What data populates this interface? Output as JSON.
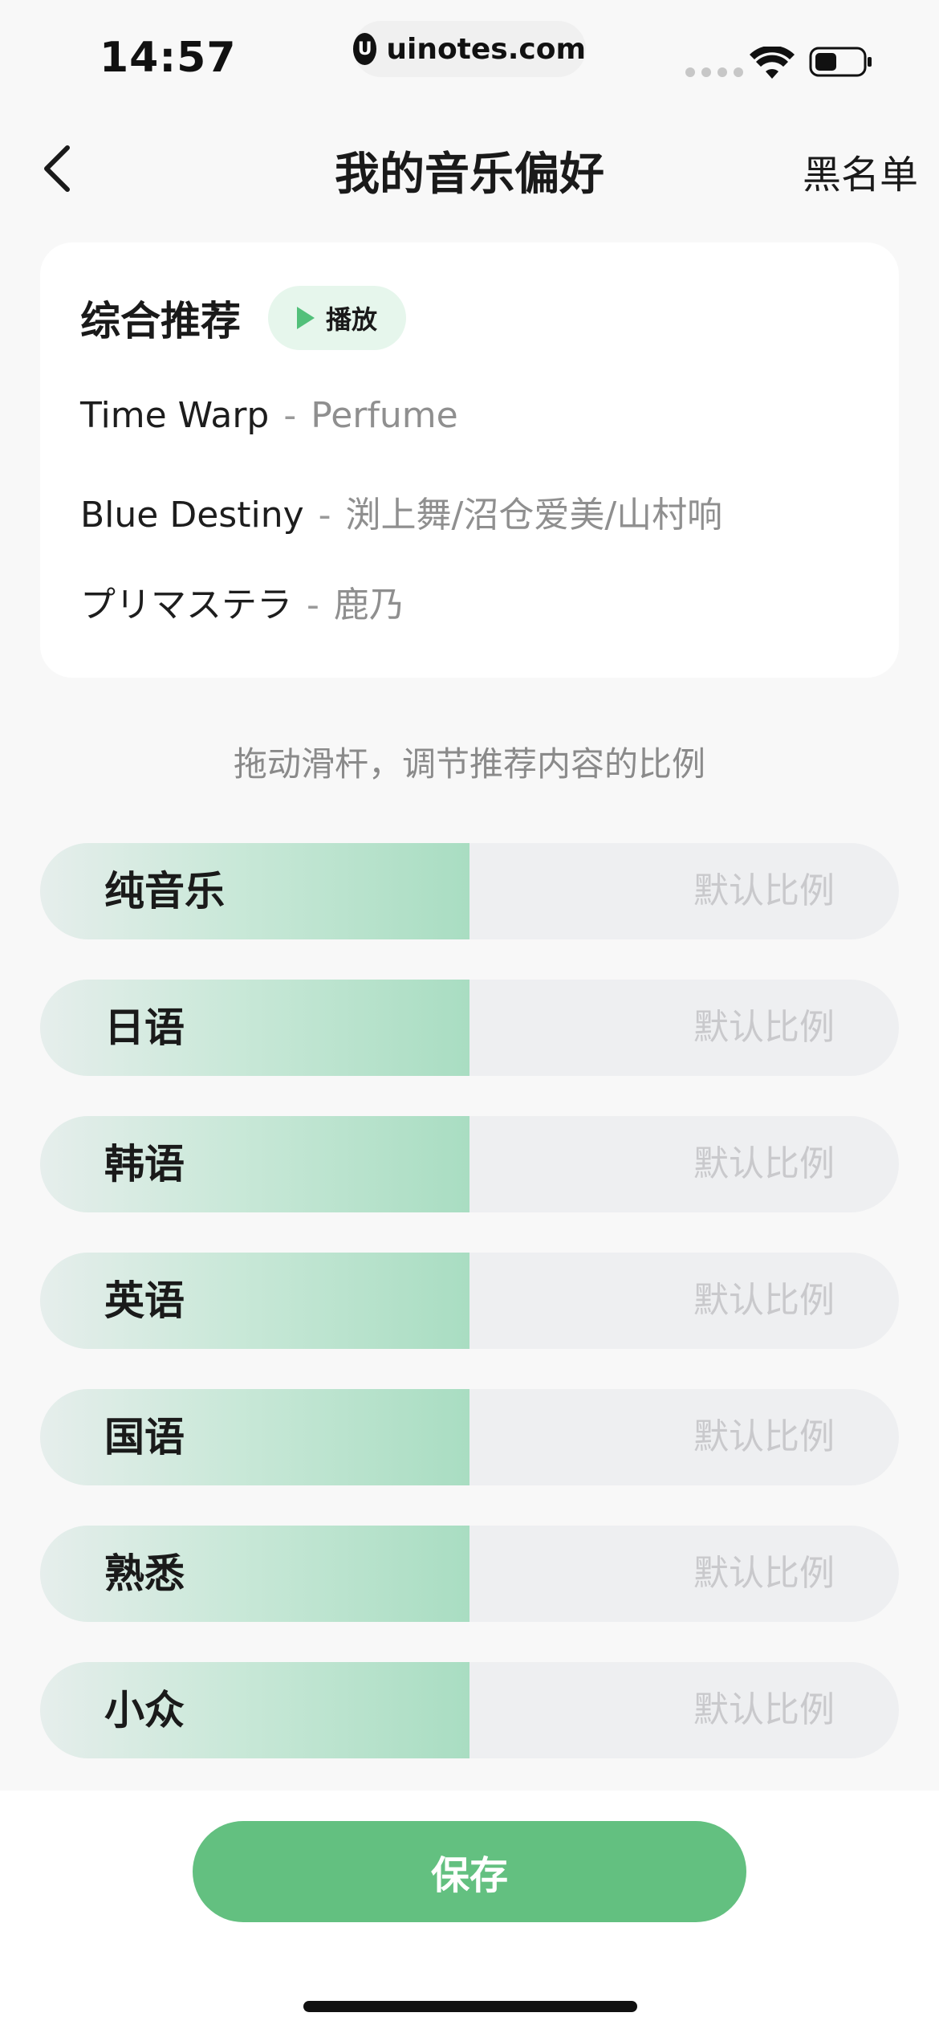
{
  "status_bar": {
    "time": "14:57",
    "url": "uinotes.com",
    "url_logo": "U"
  },
  "nav": {
    "title": "我的音乐偏好",
    "right_label": "黑名单"
  },
  "recommend": {
    "title": "综合推荐",
    "play_label": "播放",
    "songs": [
      {
        "title": "Time Warp",
        "separator": "-",
        "artist": "Perfume"
      },
      {
        "title": "Blue Destiny",
        "separator": "-",
        "artist": "渕上舞/沼仓爱美/山村响"
      },
      {
        "title": "プリマステラ",
        "separator": "-",
        "artist": "鹿乃"
      }
    ]
  },
  "hint": "拖动滑杆，调节推荐内容的比例",
  "sliders": [
    {
      "label": "纯音乐",
      "value_label": "默认比例",
      "fill_fraction": 0.5
    },
    {
      "label": "日语",
      "value_label": "默认比例",
      "fill_fraction": 0.5
    },
    {
      "label": "韩语",
      "value_label": "默认比例",
      "fill_fraction": 0.5
    },
    {
      "label": "英语",
      "value_label": "默认比例",
      "fill_fraction": 0.5
    },
    {
      "label": "国语",
      "value_label": "默认比例",
      "fill_fraction": 0.5
    },
    {
      "label": "熟悉",
      "value_label": "默认比例",
      "fill_fraction": 0.5
    },
    {
      "label": "小众",
      "value_label": "默认比例",
      "fill_fraction": 0.5
    }
  ],
  "save_label": "保存",
  "colors": {
    "accent": "#63c080",
    "play_bg": "#e6f6ec",
    "slider_track": "#eeeff1"
  }
}
